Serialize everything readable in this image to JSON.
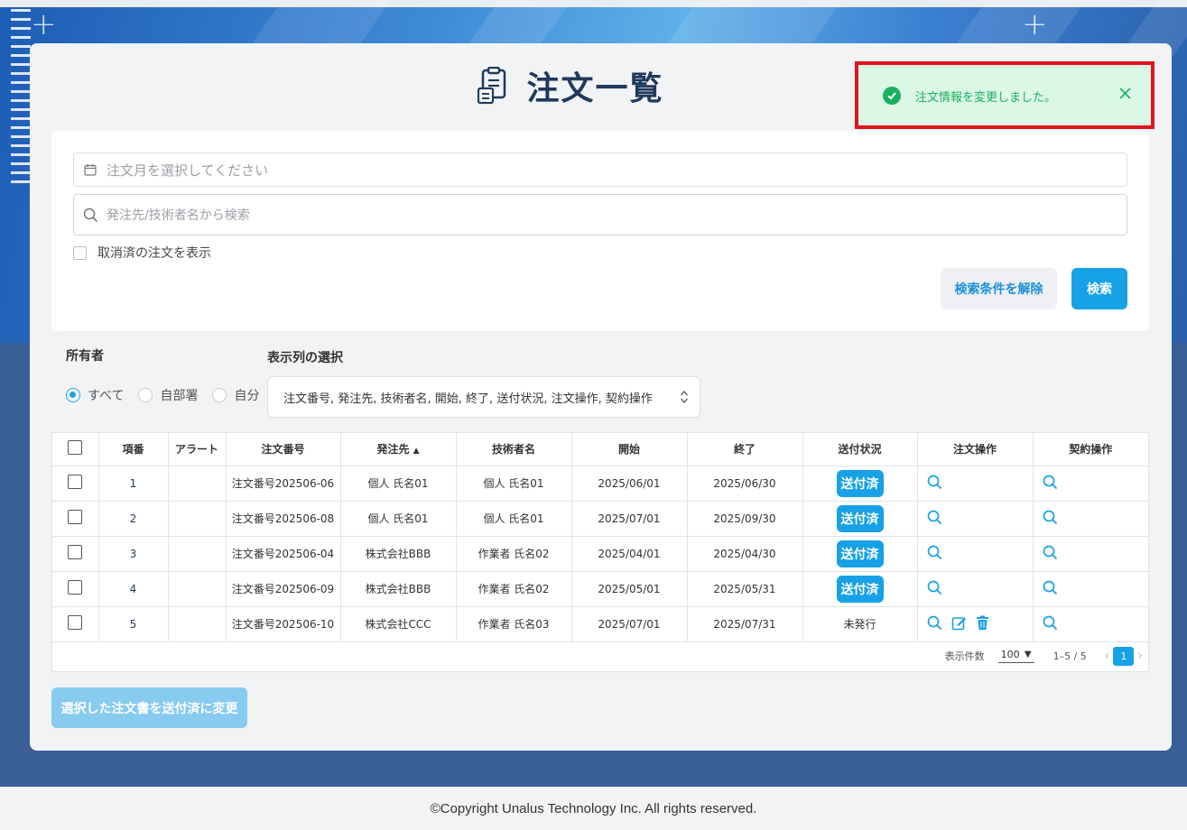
{
  "page": {
    "title": "注文一覧",
    "footer": "©Copyright Unalus Technology Inc. All rights reserved."
  },
  "toast": {
    "message": "注文情報を変更しました。",
    "icon": "check-circle-icon",
    "color": "#1ab062"
  },
  "search": {
    "month_placeholder": "注文月を選択してください",
    "keyword_placeholder": "発注先/技術者名から検索",
    "show_cancelled_label": "取消済の注文を表示",
    "show_cancelled_checked": false,
    "clear_label": "検索条件を解除",
    "search_label": "検索"
  },
  "owner": {
    "label": "所有者",
    "options": [
      "すべて",
      "自部署",
      "自分"
    ],
    "selected": "すべて"
  },
  "columns_select": {
    "label": "表示列の選択",
    "value": "注文番号, 発注先, 技術者名, 開始, 終了, 送付状況, 注文操作, 契約操作"
  },
  "table": {
    "headers": [
      "項番",
      "アラート",
      "注文番号",
      "発注先",
      "技術者名",
      "開始",
      "終了",
      "送付状況",
      "注文操作",
      "契約操作"
    ],
    "sort_column": "発注先",
    "sort_dir": "asc",
    "rows": [
      {
        "no": "1",
        "alert": "",
        "order_no": "注文番号202506-06",
        "vendor": "個人 氏名01",
        "engineer": "個人 氏名01",
        "start": "2025/06/01",
        "end": "2025/06/30",
        "status": "送付済"
      },
      {
        "no": "2",
        "alert": "",
        "order_no": "注文番号202506-08",
        "vendor": "個人 氏名01",
        "engineer": "個人 氏名01",
        "start": "2025/07/01",
        "end": "2025/09/30",
        "status": "送付済"
      },
      {
        "no": "3",
        "alert": "",
        "order_no": "注文番号202506-04",
        "vendor": "株式会社BBB",
        "engineer": "作業者 氏名02",
        "start": "2025/04/01",
        "end": "2025/04/30",
        "status": "送付済"
      },
      {
        "no": "4",
        "alert": "",
        "order_no": "注文番号202506-09",
        "vendor": "株式会社BBB",
        "engineer": "作業者 氏名02",
        "start": "2025/05/01",
        "end": "2025/05/31",
        "status": "送付済"
      },
      {
        "no": "5",
        "alert": "",
        "order_no": "注文番号202506-10",
        "vendor": "株式会社CCC",
        "engineer": "作業者 氏名03",
        "start": "2025/07/01",
        "end": "2025/07/31",
        "status": "未発行"
      }
    ]
  },
  "pager": {
    "per_page_label": "表示件数",
    "per_page": "100",
    "range": "1–5 / 5",
    "current_page": "1"
  },
  "bulk_action_label": "選択した注文書を送付済に変更",
  "colors": {
    "accent": "#17a1e6",
    "title": "#1f3a5a",
    "toast_border": "#e0141e"
  }
}
